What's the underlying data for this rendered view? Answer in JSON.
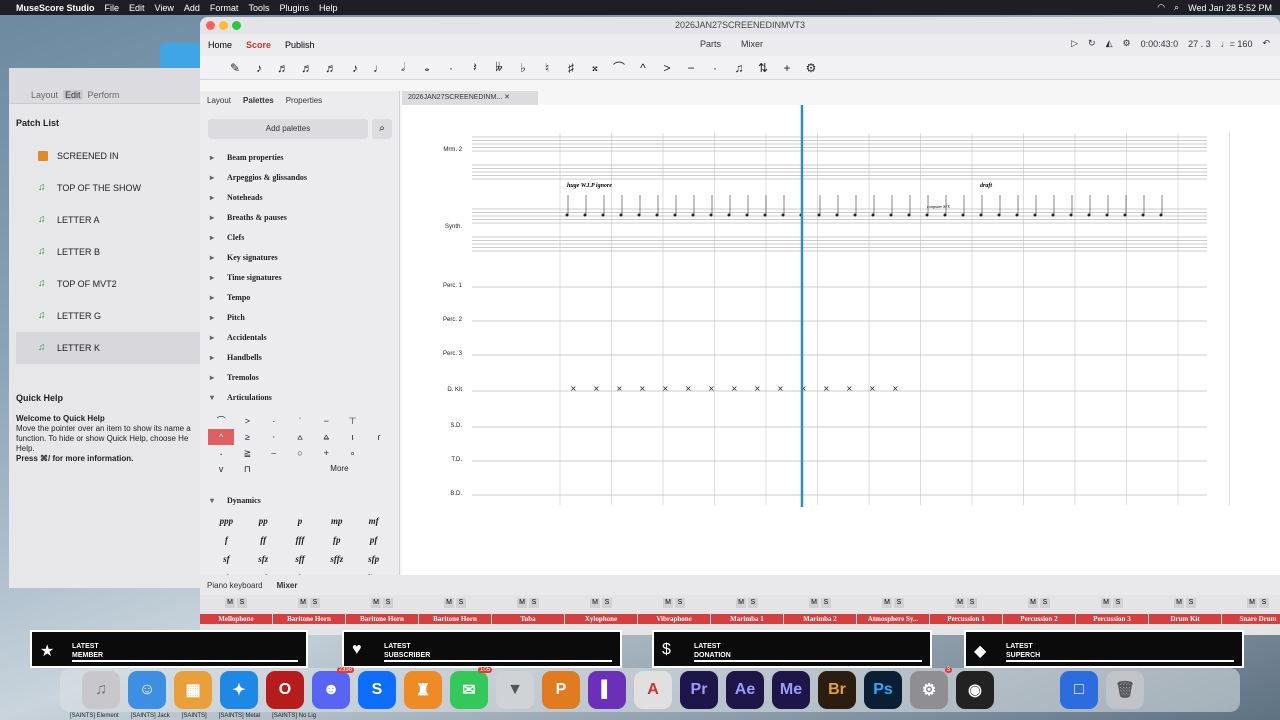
{
  "menubar": {
    "app": "MuseScore Studio",
    "items": [
      "File",
      "Edit",
      "View",
      "Add",
      "Format",
      "Tools",
      "Plugins",
      "Help"
    ],
    "clock": "Wed Jan 28  5:52 PM"
  },
  "patch": {
    "modes": [
      "Layout",
      "Edit",
      "Perform"
    ],
    "title": "Patch List",
    "items": [
      "SCREENED IN",
      "TOP OF THE SHOW",
      "LETTER A",
      "LETTER B",
      "TOP OF MVT2",
      "LETTER G",
      "LETTER K"
    ],
    "qh_title": "Quick Help",
    "qh_head": "Welcome to Quick Help",
    "qh_body": "Move the pointer over an item to show its name a function. To hide or show Quick Help, choose He Help.",
    "qh_more": "Press ⌘/ for more information."
  },
  "window": {
    "title": "2026JAN27SCREENEDINMVT3"
  },
  "nav": {
    "tabs": [
      "Home",
      "Score",
      "Publish"
    ],
    "parts": "Parts",
    "mixer": "Mixer",
    "time": "0:00:43:0",
    "pos": "27 . 3",
    "tempo": "♩= 160"
  },
  "palettes": {
    "tabs": [
      "Layout",
      "Palettes",
      "Properties"
    ],
    "add": "Add palettes",
    "items": [
      "Beam properties",
      "Arpeggios & glissandos",
      "Noteheads",
      "Breaths & pauses",
      "Clefs",
      "Key signatures",
      "Time signatures",
      "Tempo",
      "Pitch",
      "Accidentals",
      "Handbells",
      "Tremolos",
      "Articulations"
    ],
    "more": "More",
    "dynamics_title": "Dynamics",
    "dynamics": [
      "ppp",
      "pp",
      "p",
      "mp",
      "mf",
      "f",
      "ff",
      "fff",
      "fp",
      "pf",
      "sf",
      "sfz",
      "sff",
      "sffz",
      "sfp",
      "rfz",
      "rf",
      "fz",
      "cresc.",
      "dim."
    ]
  },
  "score": {
    "tab": "2026JAN27SCREENEDINM...",
    "staves": [
      "Mrm. 2",
      "Synth.",
      "Perc. 1",
      "Perc. 2",
      "Perc. 3",
      "D. Kit",
      "S.D.",
      "T.D.",
      "B.D."
    ],
    "text1": "huge W.I.P ignore",
    "text2": "draft",
    "text3": "computer SFX"
  },
  "lower": {
    "tabs": [
      "Piano keyboard",
      "Mixer"
    ]
  },
  "mixer": {
    "channels": [
      "Mellophone",
      "Baritone Horn",
      "Baritone Horn",
      "Baritone Horn",
      "Tuba",
      "Xylophone",
      "Vibraphone",
      "Marimba 1",
      "Marimba 2",
      "Atmosphere Sy...",
      "Percussion 1",
      "Percussion 2",
      "Percussion 3",
      "Drum Kit",
      "Snare Drum"
    ]
  },
  "alerts": [
    {
      "t1": "LATEST",
      "t2": "MEMBER",
      "icon": "★"
    },
    {
      "t1": "LATEST",
      "t2": "SUBSCRIBER",
      "icon": "♥"
    },
    {
      "t1": "LATEST",
      "t2": "DONATION",
      "icon": "$"
    },
    {
      "t1": "LATEST",
      "t2": "SUPERCH",
      "icon": "◆"
    }
  ],
  "dock": {
    "badges": {
      "discord": "2398",
      "messages": "105",
      "settings": "3"
    },
    "labels": [
      "[SAINTS] Element",
      "[SAINTS] Jack",
      "[SAINTS]",
      "[SAINTS] Metal",
      "[SAINTS] No Lig"
    ],
    "apps": [
      "Pr",
      "Ae",
      "Me",
      "Br",
      "Ps"
    ]
  }
}
